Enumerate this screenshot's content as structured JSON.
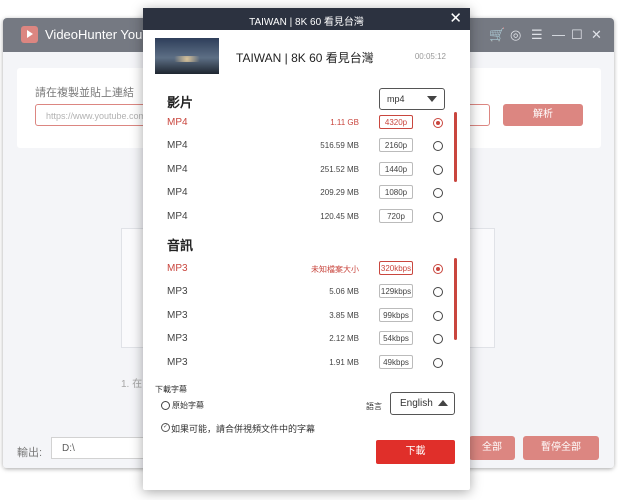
{
  "app": {
    "title": "VideoHunter YouTube",
    "url_label": "請在複製並貼上連結",
    "url_placeholder": "https://www.youtube.com/...",
    "parse_button": "解析",
    "step_text": "1. 在",
    "output_label": "輸出:",
    "output_path": "D:\\",
    "pause_all_partial": "全部",
    "pause_all": "暫停全部"
  },
  "modal": {
    "window_title": "TAIWAN | 8K 60 看見台灣",
    "video_title": "TAIWAN | 8K 60 看見台灣",
    "duration": "00:05:12",
    "video_section": "影片",
    "format_select": "mp4",
    "video_rows": [
      {
        "format": "MP4",
        "size": "1.11 GB",
        "quality": "4320p",
        "selected": true
      },
      {
        "format": "MP4",
        "size": "516.59 MB",
        "quality": "2160p",
        "selected": false
      },
      {
        "format": "MP4",
        "size": "251.52 MB",
        "quality": "1440p",
        "selected": false
      },
      {
        "format": "MP4",
        "size": "209.29 MB",
        "quality": "1080p",
        "selected": false
      },
      {
        "format": "MP4",
        "size": "120.45 MB",
        "quality": "720p",
        "selected": false
      }
    ],
    "audio_section": "音訊",
    "audio_rows": [
      {
        "format": "MP3",
        "size": "未知檔案大小",
        "quality": "320kbps",
        "selected": true
      },
      {
        "format": "MP3",
        "size": "5.06 MB",
        "quality": "129kbps",
        "selected": false
      },
      {
        "format": "MP3",
        "size": "3.85 MB",
        "quality": "99kbps",
        "selected": false
      },
      {
        "format": "MP3",
        "size": "2.12 MB",
        "quality": "54kbps",
        "selected": false
      },
      {
        "format": "MP3",
        "size": "1.91 MB",
        "quality": "49kbps",
        "selected": false
      }
    ],
    "subtitle_label": "下載字幕",
    "original_subtitle": "原始字幕",
    "language_label": "語言",
    "language_value": "English",
    "merge_label": "如果可能，請合併視頻文件中的字幕",
    "download_button": "下載"
  },
  "colors": {
    "accent": "#c9463e",
    "header": "#2c3240",
    "download": "#e02f2a"
  }
}
